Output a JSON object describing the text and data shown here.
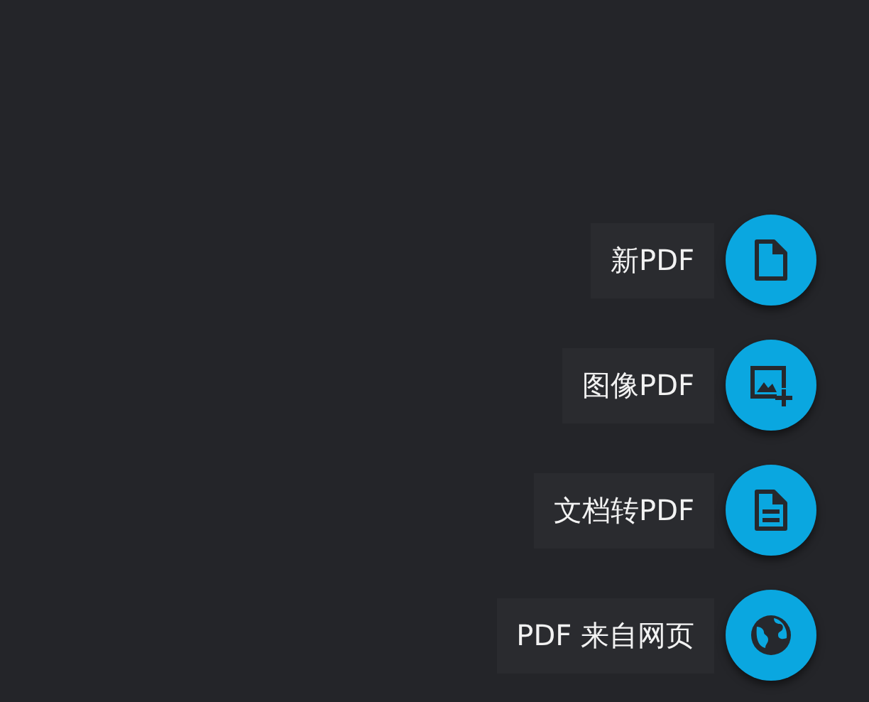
{
  "actions": [
    {
      "label": "新PDF",
      "kind": "file"
    },
    {
      "label": "图像PDF",
      "kind": "image"
    },
    {
      "label": "文档转PDF",
      "kind": "document"
    },
    {
      "label": "PDF 来自网页",
      "kind": "web"
    }
  ]
}
